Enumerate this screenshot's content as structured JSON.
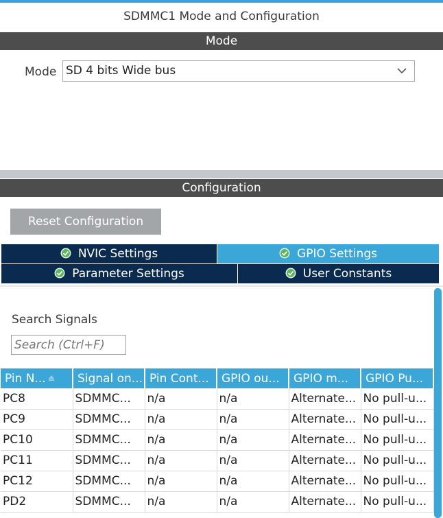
{
  "panel": {
    "title": "SDMMC1 Mode and Configuration"
  },
  "mode_section": {
    "header": "Mode",
    "label": "Mode",
    "selected_value": "SD 4 bits Wide bus"
  },
  "config_section": {
    "header": "Configuration",
    "reset_button": "Reset Configuration",
    "tabs": [
      {
        "label": "NVIC Settings",
        "active": false,
        "icon": "check-circle-icon"
      },
      {
        "label": "GPIO Settings",
        "active": true,
        "icon": "check-circle-icon"
      },
      {
        "label": "Parameter Settings",
        "active": false,
        "icon": "check-circle-icon"
      },
      {
        "label": "User Constants",
        "active": false,
        "icon": "check-circle-icon"
      }
    ],
    "search_label": "Search Signals",
    "search_placeholder": "Search (Ctrl+F)"
  },
  "table": {
    "columns": [
      "Pin N...",
      "Signal on...",
      "Pin Cont...",
      "GPIO ou...",
      "GPIO m...",
      "GPIO Pu..."
    ],
    "rows": [
      [
        "PC8",
        "SDMMC...",
        "n/a",
        "n/a",
        "Alternate...",
        "No pull-u..."
      ],
      [
        "PC9",
        "SDMMC...",
        "n/a",
        "n/a",
        "Alternate...",
        "No pull-u..."
      ],
      [
        "PC10",
        "SDMMC...",
        "n/a",
        "n/a",
        "Alternate...",
        "No pull-u..."
      ],
      [
        "PC11",
        "SDMMC...",
        "n/a",
        "n/a",
        "Alternate...",
        "No pull-u..."
      ],
      [
        "PC12",
        "SDMMC...",
        "n/a",
        "n/a",
        "Alternate...",
        "No pull-u..."
      ],
      [
        "PD2",
        "SDMMC...",
        "n/a",
        "n/a",
        "Alternate...",
        "No pull-u..."
      ]
    ]
  },
  "colors": {
    "accent": "#3ba6d8",
    "tab_dark": "#0b2a4f",
    "section_bar": "#4d4d4d",
    "button_gray": "#a3a6a9"
  }
}
